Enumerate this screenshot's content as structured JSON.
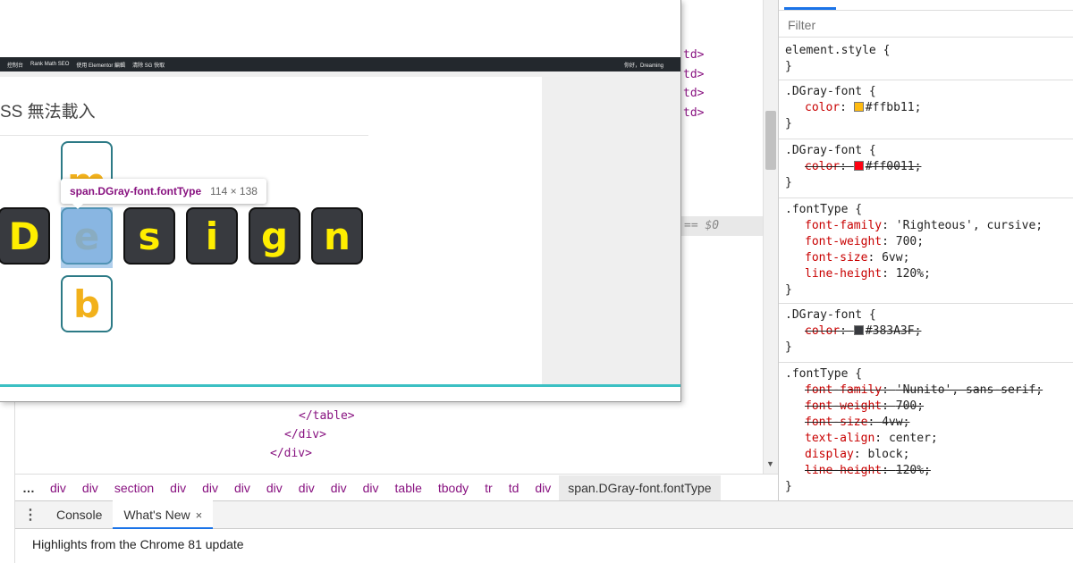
{
  "elements": {
    "lines": [
      "td>",
      "td>",
      "td>",
      "td>",
      "</table>",
      "</div>",
      "</div>"
    ],
    "selected_marker": "== $0"
  },
  "breadcrumbs": {
    "ellipsis": "…",
    "items": [
      "div",
      "div",
      "section",
      "div",
      "div",
      "div",
      "div",
      "div",
      "div",
      "div",
      "table",
      "tbody",
      "tr",
      "td",
      "div"
    ],
    "current": "span.DGray-font.fontType"
  },
  "styles": {
    "filter_placeholder": "Filter",
    "rules": {
      "r1": {
        "selector": "element.style {",
        "close": "}"
      },
      "r2": {
        "selector": ".DGray-font {",
        "prop": "color",
        "value": "#ffbb11;",
        "swatch": "#ffbb11",
        "close": "}"
      },
      "r3": {
        "selector": ".DGray-font {",
        "prop": "color",
        "value": "#ff0011;",
        "swatch": "#ff0011",
        "close": "}"
      },
      "r4": {
        "selector": ".fontType {",
        "decls": [
          {
            "prop": "font-family",
            "value": "'Righteous', cursive;"
          },
          {
            "prop": "font-weight",
            "value": "700;"
          },
          {
            "prop": "font-size",
            "value": "6vw;"
          },
          {
            "prop": "line-height",
            "value": "120%;"
          }
        ],
        "close": "}"
      },
      "r5": {
        "selector": ".DGray-font {",
        "prop": "color",
        "value": "#383A3F;",
        "swatch": "#383a3f",
        "close": "}"
      },
      "r6": {
        "selector": ".fontType {",
        "decls": [
          {
            "prop": "font-family",
            "value": "'Nunito', sans-serif;"
          },
          {
            "prop": "font-weight",
            "value": "700;"
          },
          {
            "prop": "font-size",
            "value": "4vw;"
          },
          {
            "prop": "text-align",
            "value": "center;"
          },
          {
            "prop": "display",
            "value": "block;"
          },
          {
            "prop": "line-height",
            "value": "120%;"
          }
        ],
        "close": "}"
      }
    }
  },
  "drawer": {
    "tabs": [
      "Console",
      "What's New"
    ],
    "close_icon": "×",
    "body_text": "Highlights from the Chrome 81 update"
  },
  "browser": {
    "adminbar": {
      "items": [
        "控制台",
        "Rank Math SEO",
        "使用 Elementor 編輯",
        "清除 SG 快取"
      ],
      "right": "你好，Dreaming"
    },
    "heading": "SS 無法載入",
    "letters": [
      "D",
      "e",
      "s",
      "i",
      "g",
      "n"
    ],
    "alt_top": "m",
    "alt_bottom": "b",
    "tooltip": {
      "name": "span.DGray-font.fontType",
      "size": "114 × 138"
    }
  },
  "colors": {
    "tile_bg": "#383a3f",
    "tile_text": "#ffee00",
    "alt_text": "#f2b11b",
    "highlight": "#6fa8dc",
    "accent": "#1a73e8"
  }
}
